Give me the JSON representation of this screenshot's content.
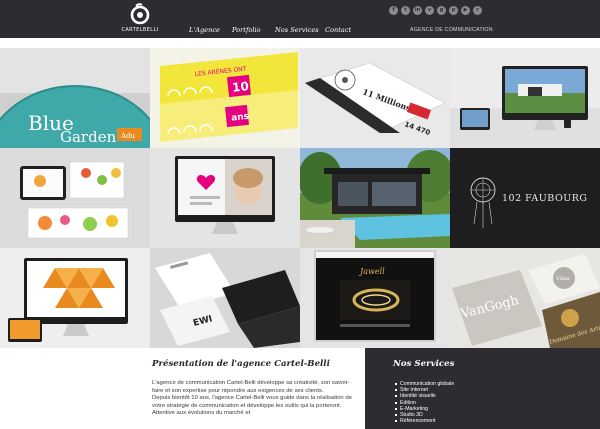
{
  "brand": {
    "logo_text": "CARTELBELLI"
  },
  "nav": {
    "items": [
      {
        "label": "L'Agence"
      },
      {
        "label": "Portfolio"
      },
      {
        "label": "Nos Services"
      },
      {
        "label": "Contact"
      }
    ]
  },
  "social": {
    "icons": [
      {
        "name": "facebook-icon",
        "glyph": "f"
      },
      {
        "name": "twitter-icon",
        "glyph": "t"
      },
      {
        "name": "linkedin-icon",
        "glyph": "in"
      },
      {
        "name": "viadeo-icon",
        "glyph": "v"
      },
      {
        "name": "google-plus-icon",
        "glyph": "g"
      },
      {
        "name": "pinterest-icon",
        "glyph": "p"
      },
      {
        "name": "youtube-icon",
        "glyph": "▶"
      },
      {
        "name": "rss-icon",
        "glyph": "r"
      }
    ]
  },
  "header": {
    "agency_label": "AGENCE DE COMMUNICATION"
  },
  "portfolio": {
    "tiles": [
      {
        "name": "tile-blue-garden",
        "texts": [
          "Blue",
          "Garden",
          "Adu"
        ]
      },
      {
        "name": "tile-arenes-10-ans",
        "texts": [
          "LES ARÈNES ONT",
          "10",
          "ans"
        ]
      },
      {
        "name": "tile-brochure-millions",
        "texts": [
          "11 Millions",
          "14 470"
        ]
      },
      {
        "name": "tile-imac-website",
        "texts": []
      },
      {
        "name": "tile-tablet-catalog",
        "texts": []
      },
      {
        "name": "tile-imac-child",
        "texts": []
      },
      {
        "name": "tile-villa-3d",
        "texts": []
      },
      {
        "name": "tile-102-faubourg",
        "texts": [
          "102 FAUBOURG"
        ]
      },
      {
        "name": "tile-imac-triangles",
        "texts": []
      },
      {
        "name": "tile-business-cards",
        "texts": [
          "EWI"
        ]
      },
      {
        "name": "tile-jewelry-site",
        "texts": [
          "Jawell"
        ]
      },
      {
        "name": "tile-vangogh-packaging",
        "texts": [
          "VanGogh",
          "Villas",
          "Domaine des Artistes"
        ]
      }
    ]
  },
  "presentation": {
    "title": "Présentation de l'agence Cartel-Belli",
    "paragraph1": "L'agence de communication Cartel-Belli développe sa créativité, son savoir-faire et son expertise pour répondre aux exigences de ses clients.",
    "paragraph2": "Depuis bientôt 10 ans, l'agence Cartel-Belli vous guide dans la réalisation de votre stratégie de communication et développe les outils qui la porteront. Attentive aux évolutions du marché et"
  },
  "services": {
    "title": "Nos Services",
    "items": [
      {
        "label": "Communication globale"
      },
      {
        "label": "Site Internet"
      },
      {
        "label": "Identité visuelle"
      },
      {
        "label": "Edition"
      },
      {
        "label": "E-Marketing"
      },
      {
        "label": "Studio 3D"
      },
      {
        "label": "Référencement"
      }
    ]
  },
  "colors": {
    "header_bg": "#2e2c31",
    "accent_pink": "#e4007e",
    "accent_yellow": "#f2e63a",
    "accent_orange": "#e88a1d",
    "accent_teal": "#4fb5b3"
  }
}
